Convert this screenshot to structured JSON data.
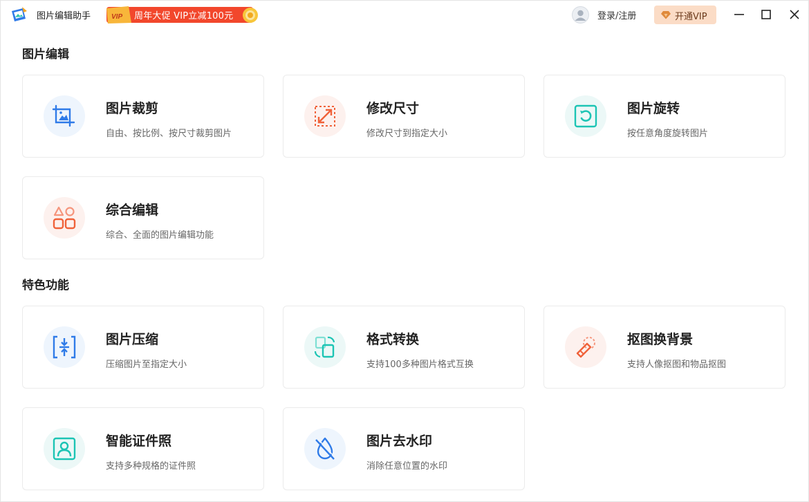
{
  "app": {
    "title": "图片编辑助手"
  },
  "promo": {
    "badge": "VIP",
    "text": "周年大促 VIP立减100元"
  },
  "header": {
    "login_label": "登录/注册",
    "vip_label": "开通VIP"
  },
  "colors": {
    "accent_blue": "#2f7be8",
    "accent_orange": "#f0623a",
    "accent_teal": "#1cc4b4",
    "vip_bg": "#fbdcc6"
  },
  "sections": [
    {
      "title": "图片编辑",
      "cards": [
        {
          "title": "图片裁剪",
          "desc": "自由、按比例、按尺寸裁剪图片",
          "icon": "crop-icon"
        },
        {
          "title": "修改尺寸",
          "desc": "修改尺寸到指定大小",
          "icon": "resize-icon"
        },
        {
          "title": "图片旋转",
          "desc": "按任意角度旋转图片",
          "icon": "rotate-icon"
        },
        {
          "title": "综合编辑",
          "desc": "综合、全面的图片编辑功能",
          "icon": "shapes-icon"
        }
      ]
    },
    {
      "title": "特色功能",
      "cards": [
        {
          "title": "图片压缩",
          "desc": "压缩图片至指定大小",
          "icon": "compress-icon"
        },
        {
          "title": "格式转换",
          "desc": "支持100多种图片格式互换",
          "icon": "convert-icon"
        },
        {
          "title": "抠图换背景",
          "desc": "支持人像抠图和物品抠图",
          "icon": "cutout-icon"
        },
        {
          "title": "智能证件照",
          "desc": "支持多种规格的证件照",
          "icon": "id-photo-icon"
        },
        {
          "title": "图片去水印",
          "desc": "消除任意位置的水印",
          "icon": "remove-watermark-icon"
        }
      ]
    }
  ]
}
